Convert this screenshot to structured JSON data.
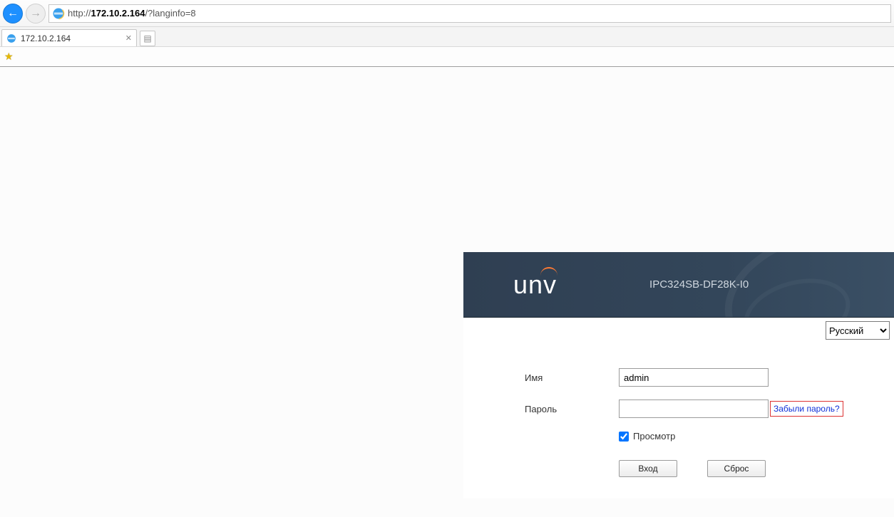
{
  "browser": {
    "url_prefix": "http://",
    "url_host": "172.10.2.164",
    "url_suffix": "/?langinfo=8",
    "tab_title": "172.10.2.164"
  },
  "panel": {
    "logo_text": "unv",
    "model": "IPC324SB-DF28K-I0"
  },
  "lang": {
    "selected": "Русский",
    "options": [
      "Русский"
    ]
  },
  "form": {
    "username_label": "Имя",
    "username_value": "admin",
    "password_label": "Пароль",
    "password_value": "",
    "forgot_label": "Забыли пароль?",
    "live_view_label": "Просмотр",
    "live_view_checked": true,
    "login_button": "Вход",
    "reset_button": "Сброс"
  }
}
